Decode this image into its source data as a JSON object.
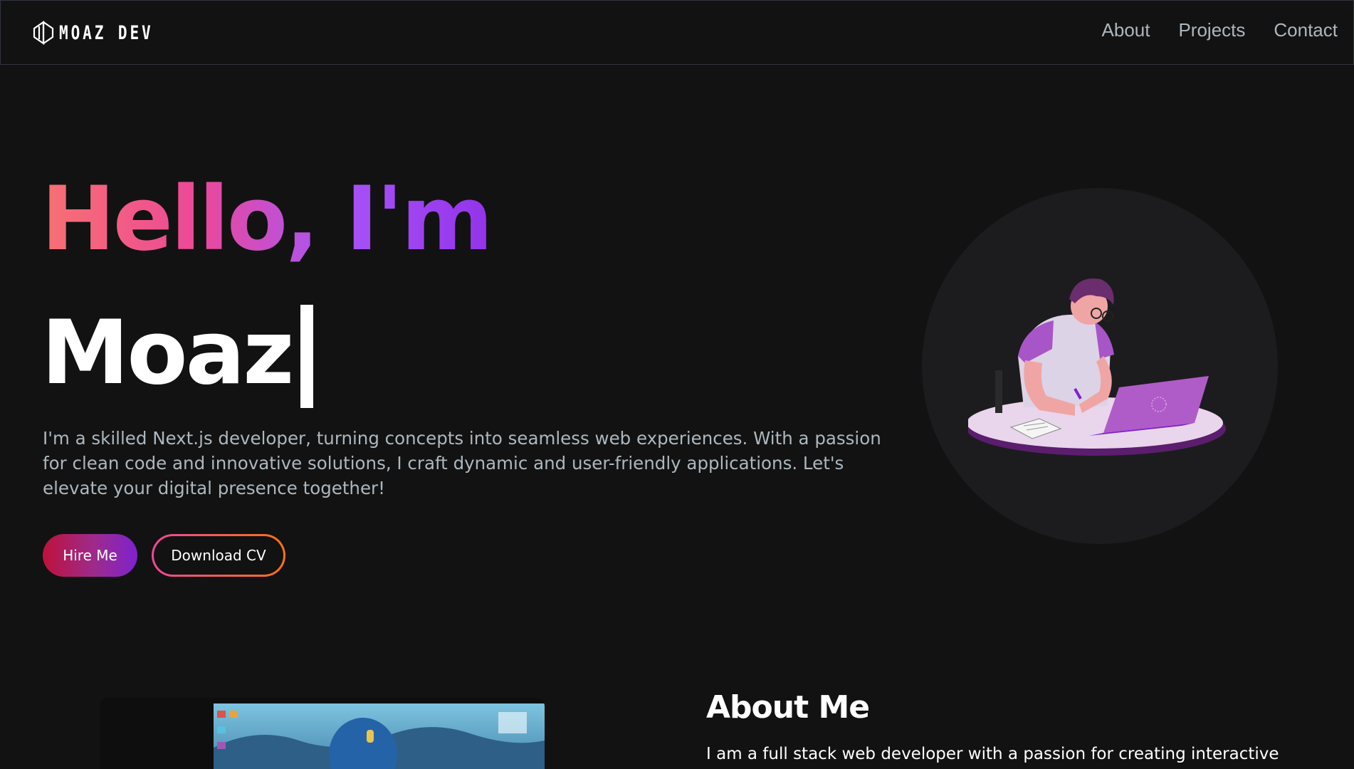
{
  "navbar": {
    "logo_text": "MOAZ DEV",
    "links": [
      {
        "label": "About"
      },
      {
        "label": "Projects"
      },
      {
        "label": "Contact"
      }
    ]
  },
  "hero": {
    "greeting": "Hello, I'm",
    "name": "Moaz",
    "description": "I'm a skilled Next.js developer, turning concepts into seamless web experiences. With a passion for clean code and innovative solutions, I craft dynamic and user-friendly applications. Let's elevate your digital presence together!",
    "hire_button": "Hire Me",
    "cv_button": "Download CV"
  },
  "about": {
    "title": "About Me",
    "text": "I am a full stack web developer with a passion for creating interactive"
  },
  "colors": {
    "background": "#121212",
    "muted_text": "#adb7be",
    "gradient_start": "#f87171",
    "gradient_end": "#9333ea",
    "accent_orange": "#f97316"
  }
}
